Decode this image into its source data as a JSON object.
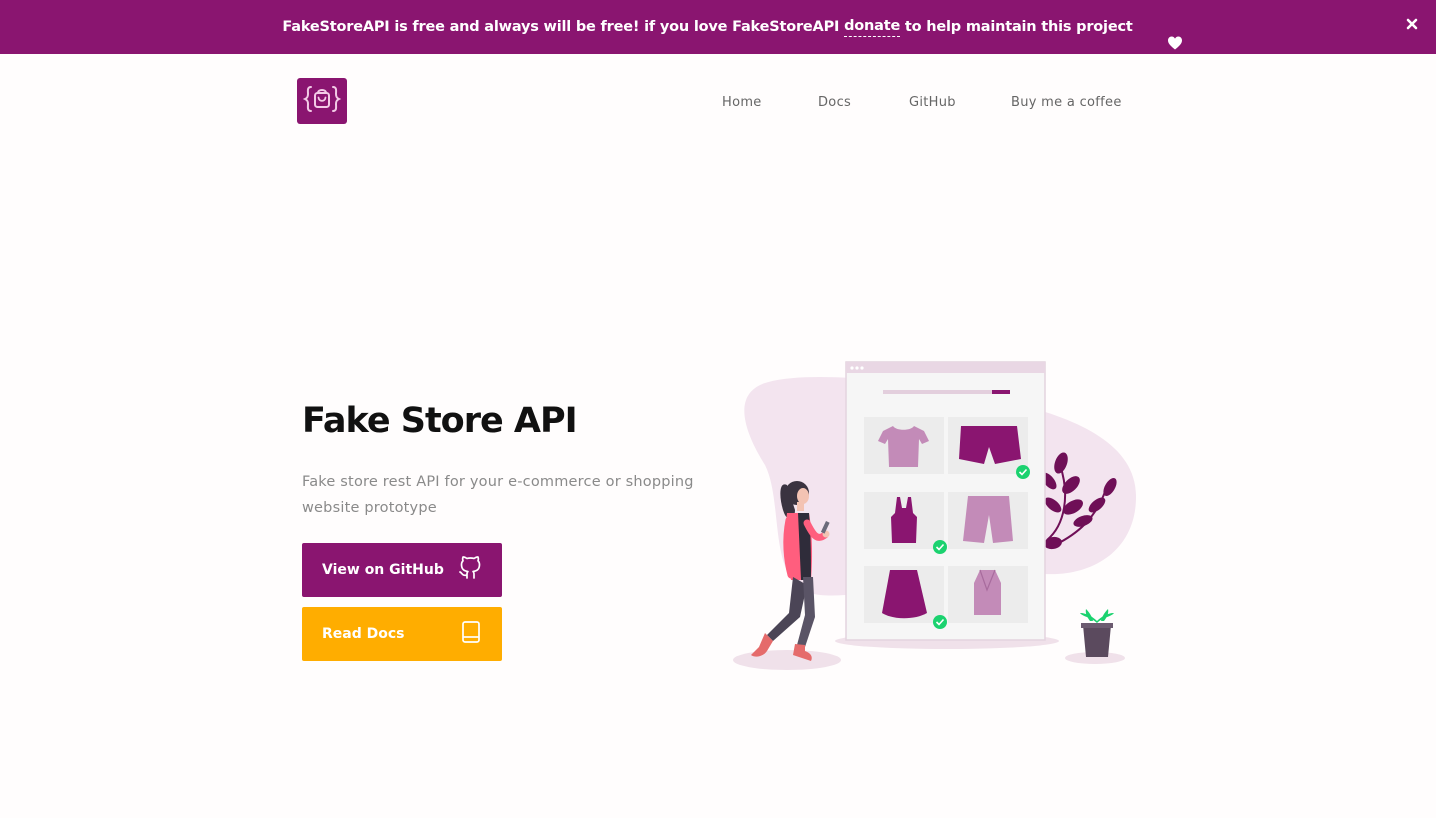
{
  "banner": {
    "text_before": "FakeStoreAPI is free and always will be free! if you love FakeStoreAPI ",
    "donate_link": "donate",
    "text_after": " to help maintain this project",
    "close_icon": "close-icon",
    "heart_icon": "heart-icon"
  },
  "header": {
    "logo_icon": "shopping-bag-braces-icon",
    "nav": [
      {
        "label": "Home"
      },
      {
        "label": "Docs"
      },
      {
        "label": "GitHub"
      },
      {
        "label": "Buy me a coffee"
      }
    ]
  },
  "hero": {
    "title": "Fake Store API",
    "subtitle": "Fake store rest API for your e-commerce or shopping website prototype",
    "buttons": [
      {
        "label": "View on GitHub",
        "icon": "github-icon"
      },
      {
        "label": "Read Docs",
        "icon": "book-icon"
      }
    ],
    "illustration": "woman-shopping-online-illustration"
  },
  "colors": {
    "brand": "#8a1570",
    "accent": "#ffad00",
    "check": "#1bd26f"
  }
}
